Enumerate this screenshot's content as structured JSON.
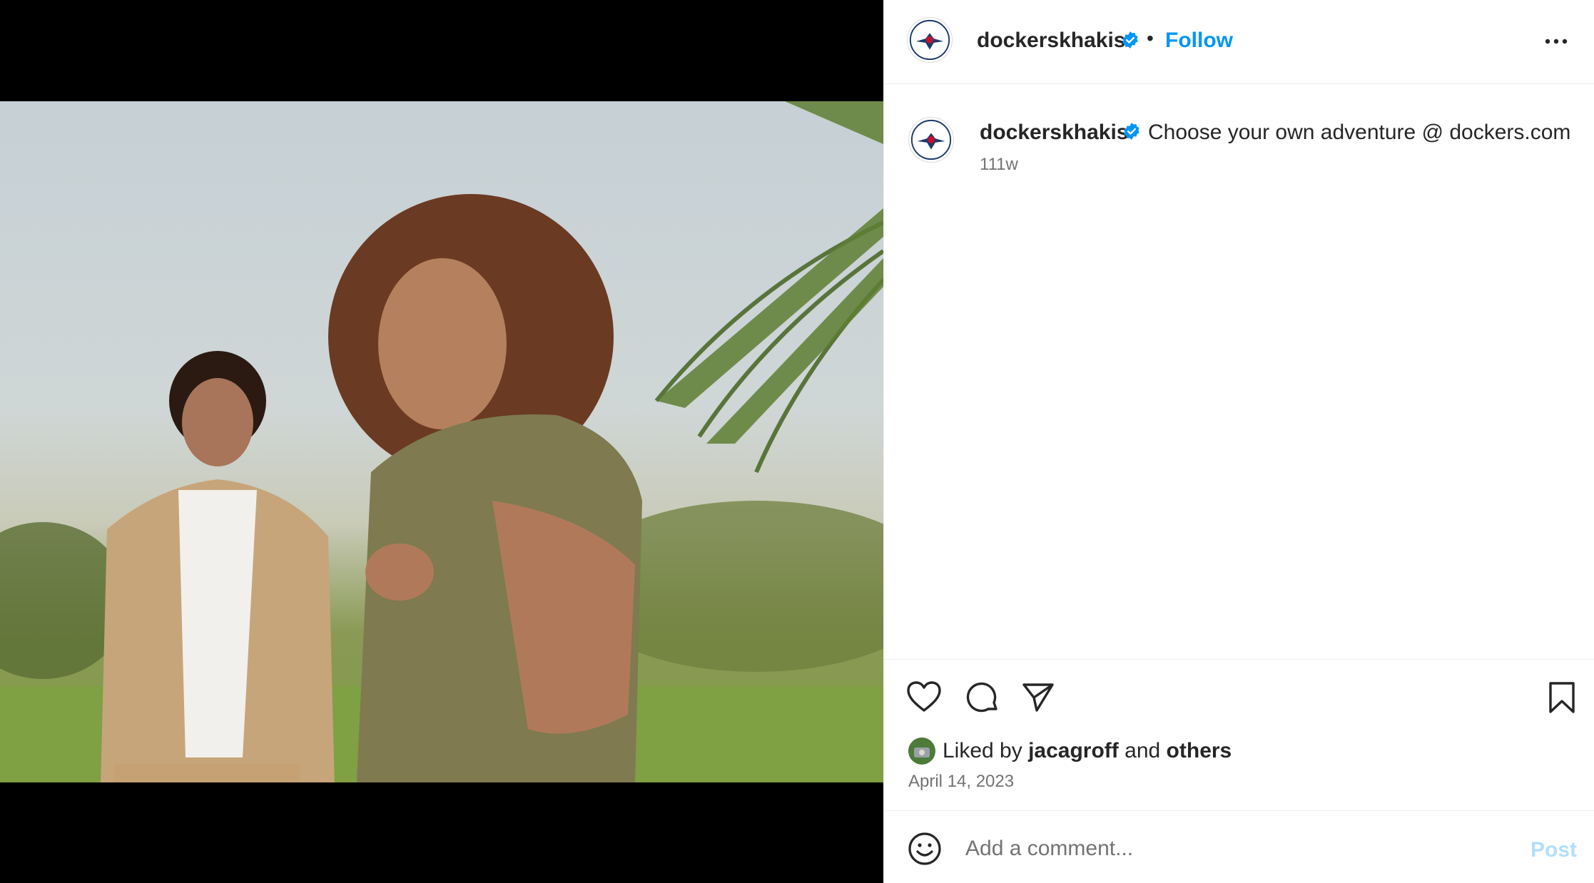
{
  "post": {
    "username": "dockerskhakis",
    "verified": true,
    "follow_label": "Follow",
    "separator": "•",
    "more_icon": "more-horizontal-icon",
    "caption": {
      "username": "dockerskhakis",
      "text": "Choose your own adventure @ dockers.com",
      "time_ago": "111w"
    },
    "actions": {
      "like_icon": "heart-icon",
      "comment_icon": "comment-icon",
      "share_icon": "paper-plane-icon",
      "save_icon": "bookmark-icon"
    },
    "likes": {
      "prefix": "Liked by",
      "user": "jacagroff",
      "joiner": "and",
      "others": "others"
    },
    "date": "April 14, 2023",
    "comment": {
      "placeholder": "Add a comment...",
      "post_label": "Post",
      "emoji_icon": "smiley-icon"
    }
  },
  "colors": {
    "link": "#0095f6",
    "post_disabled": "#b2dffc",
    "verified": "#0095f6",
    "secondary_text": "#737373"
  }
}
